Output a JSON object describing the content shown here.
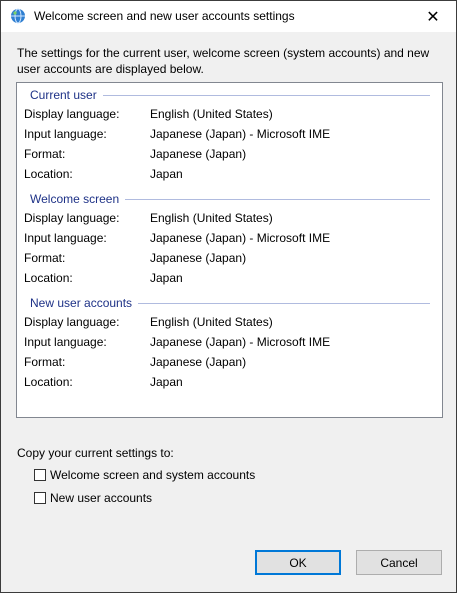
{
  "window": {
    "title": "Welcome screen and new user accounts settings",
    "close_glyph": "✕"
  },
  "intro": "The settings for the current user, welcome screen (system accounts) and new user accounts are displayed below.",
  "groups": [
    {
      "label": "Current user",
      "rows": [
        {
          "key": "Display language:",
          "value": "English (United States)"
        },
        {
          "key": "Input language:",
          "value": "Japanese (Japan) - Microsoft IME"
        },
        {
          "key": "Format:",
          "value": "Japanese (Japan)"
        },
        {
          "key": "Location:",
          "value": "Japan"
        }
      ]
    },
    {
      "label": "Welcome screen",
      "rows": [
        {
          "key": "Display language:",
          "value": "English (United States)"
        },
        {
          "key": "Input language:",
          "value": "Japanese (Japan) - Microsoft IME"
        },
        {
          "key": "Format:",
          "value": "Japanese (Japan)"
        },
        {
          "key": "Location:",
          "value": "Japan"
        }
      ]
    },
    {
      "label": "New user accounts",
      "rows": [
        {
          "key": "Display language:",
          "value": "English (United States)"
        },
        {
          "key": "Input language:",
          "value": "Japanese (Japan) - Microsoft IME"
        },
        {
          "key": "Format:",
          "value": "Japanese (Japan)"
        },
        {
          "key": "Location:",
          "value": "Japan"
        }
      ]
    }
  ],
  "copy": {
    "label": "Copy your current settings to:",
    "options": [
      {
        "label": "Welcome screen and system accounts",
        "checked": false
      },
      {
        "label": "New user accounts",
        "checked": false
      }
    ]
  },
  "buttons": {
    "ok": "OK",
    "cancel": "Cancel"
  },
  "colors": {
    "group_label": "#1e3287",
    "ok_border": "#0078d7"
  }
}
